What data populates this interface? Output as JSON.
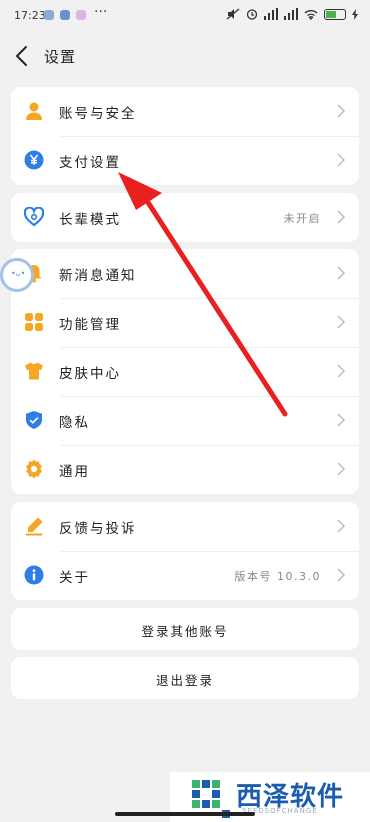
{
  "status_bar": {
    "time": "17:23",
    "battery": "100"
  },
  "header": {
    "title": "设置"
  },
  "group1": [
    {
      "label": "账号与安全",
      "icon": "user-icon"
    },
    {
      "label": "支付设置",
      "icon": "yuan-icon"
    }
  ],
  "group2": [
    {
      "label": "长辈模式",
      "value": "未开启",
      "icon": "heart-icon"
    }
  ],
  "group3": [
    {
      "label": "新消息通知",
      "icon": "bell-icon"
    },
    {
      "label": "功能管理",
      "icon": "grid-icon"
    },
    {
      "label": "皮肤中心",
      "icon": "shirt-icon"
    },
    {
      "label": "隐私",
      "icon": "shield-icon"
    },
    {
      "label": "通用",
      "icon": "gear-icon"
    }
  ],
  "group4": [
    {
      "label": "反馈与投诉",
      "icon": "pen-icon"
    },
    {
      "label": "关于",
      "value": "版本号 10.3.0",
      "icon": "info-icon"
    }
  ],
  "buttons": {
    "switch_account": "登录其他账号",
    "logout": "退出登录"
  },
  "watermark": {
    "title": "西泽软件",
    "subtitle": "SEEDSOFCHANGE"
  },
  "colors": {
    "accent_orange": "#f5a623",
    "accent_blue": "#2f7ee6",
    "arrow_red": "#e82020"
  }
}
